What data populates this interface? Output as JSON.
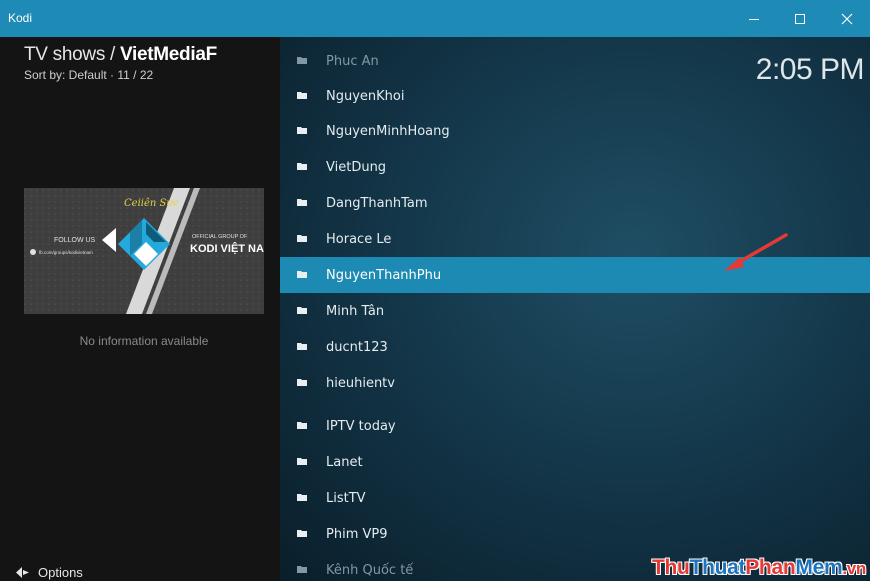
{
  "window": {
    "title": "Kodi",
    "controls": {
      "minimize": "minimize-icon",
      "maximize": "maximize-icon",
      "close": "close-icon"
    }
  },
  "header": {
    "title_prefix": "TV shows / ",
    "title_strong": "VietMediaF",
    "sort_info": "Sort by: Default  ·  11 / 22"
  },
  "clock": "2:05 PM",
  "info": {
    "no_info": "No information available",
    "banner": {
      "script_title": "Ceiiên Sưe",
      "follow": "FOLLOW US",
      "url": "fb.com/groups/kodivietnam",
      "official": "OFFICIAL GROUP OF",
      "brand": "KODI VIỆT NAM"
    }
  },
  "footer": {
    "options_label": "Options",
    "options_icon": "options-icon"
  },
  "list": {
    "selected_index": 6,
    "items": [
      {
        "label": "Phuc An",
        "icon": "folder-icon"
      },
      {
        "label": "NguyenKhoi",
        "icon": "folder-icon"
      },
      {
        "label": "NguyenMinhHoang",
        "icon": "folder-icon"
      },
      {
        "label": "VietDung",
        "icon": "folder-icon"
      },
      {
        "label": "DangThanhTam",
        "icon": "folder-icon"
      },
      {
        "label": "Horace Le",
        "icon": "folder-icon"
      },
      {
        "label": "NguyenThanhPhu",
        "icon": "folder-icon"
      },
      {
        "label": "Minh Tân",
        "icon": "folder-icon"
      },
      {
        "label": "ducnt123",
        "icon": "folder-icon"
      },
      {
        "label": "hieuhientv",
        "icon": "folder-icon"
      },
      {
        "label": "IPTV today",
        "icon": "folder-icon"
      },
      {
        "label": "Lanet",
        "icon": "folder-icon"
      },
      {
        "label": "ListTV",
        "icon": "folder-icon"
      },
      {
        "label": "Phim VP9",
        "icon": "folder-icon"
      },
      {
        "label": "Kênh Quốc tế",
        "icon": "folder-icon"
      }
    ]
  },
  "watermark": {
    "part1": "Thu",
    "part2": "Thuat",
    "part3": "Phan",
    "part4": "Mem",
    "part5": ".vn"
  },
  "colors": {
    "titlebar": "#1e8bb6",
    "selected_row": "#1c8ab2",
    "left_panel": "#141414",
    "annotation_arrow": "#e53935"
  }
}
